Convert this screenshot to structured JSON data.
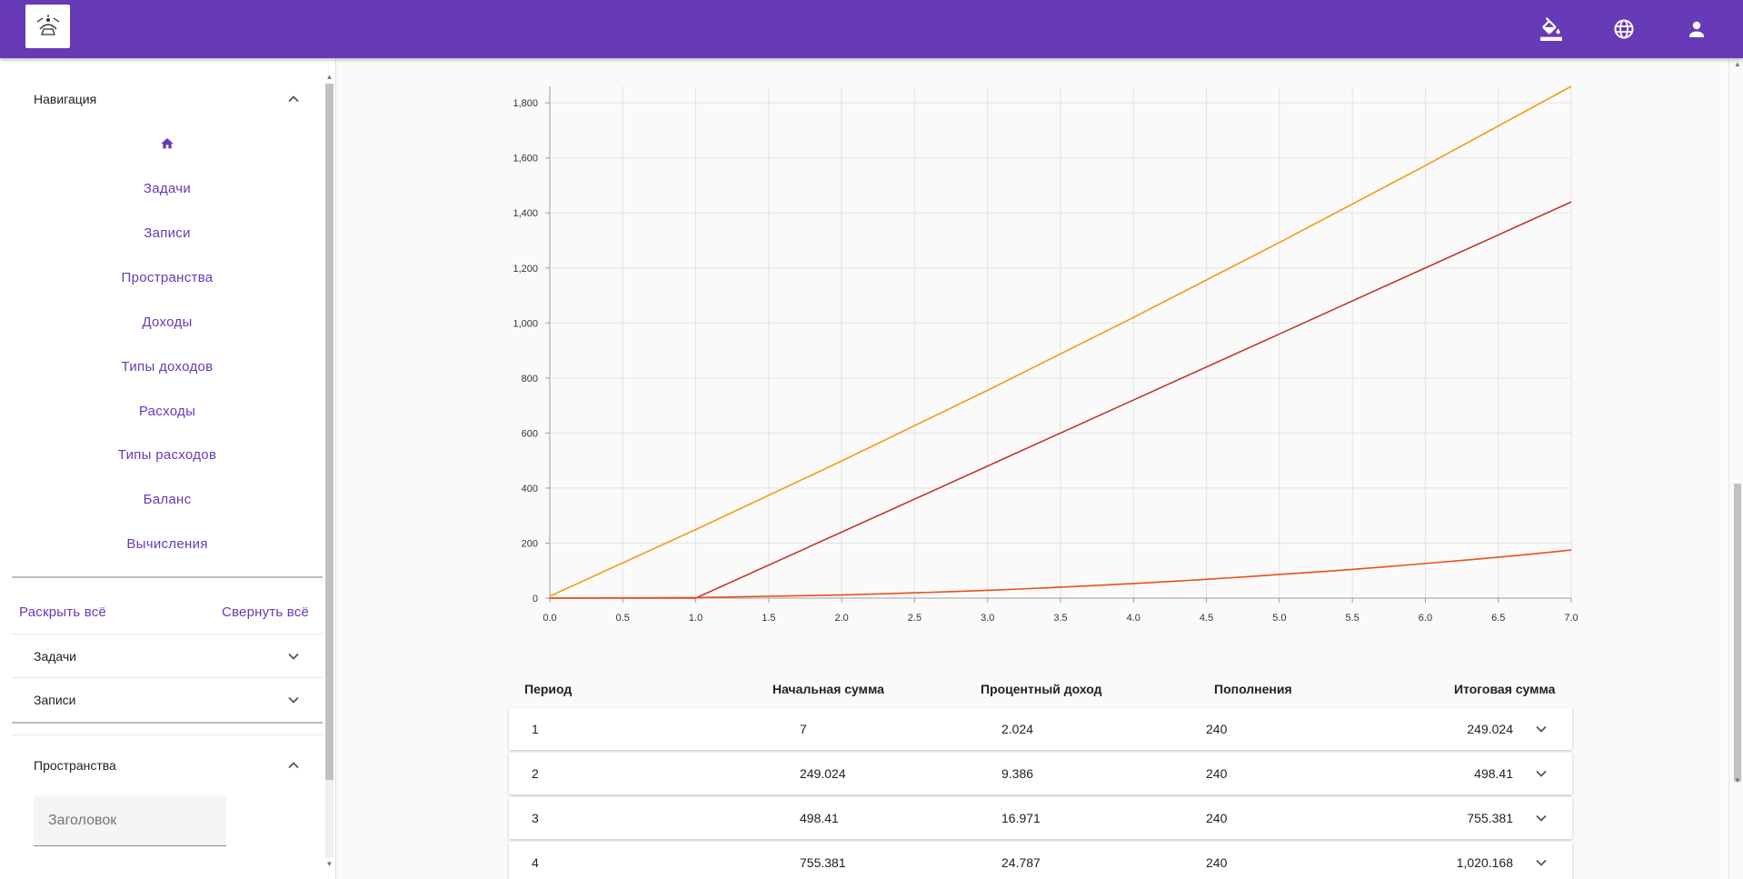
{
  "header": {
    "logo": "app-logo",
    "icons": [
      "paint-bucket-icon",
      "globe-icon",
      "account-icon"
    ]
  },
  "sidebar": {
    "navigation": {
      "title": "Навигация",
      "home_icon": "home-icon",
      "items": [
        "Задачи",
        "Записи",
        "Пространства",
        "Доходы",
        "Типы доходов",
        "Расходы",
        "Типы расходов",
        "Баланс",
        "Вычисления"
      ]
    },
    "expand_all": "Раскрыть всё",
    "collapse_all": "Свернуть всё",
    "panels": [
      {
        "title": "Задачи",
        "state": "collapsed"
      },
      {
        "title": "Записи",
        "state": "collapsed"
      }
    ],
    "spaces": {
      "title": "Пространства",
      "state": "expanded",
      "input_placeholder": "Заголовок"
    }
  },
  "colors": {
    "primary": "#673ab7",
    "series_total": "#f39c12",
    "series_deposits": "#c0392b",
    "series_interest": "#e8501a"
  },
  "chart_data": {
    "type": "line",
    "xlim": [
      0,
      7
    ],
    "ylim": [
      0,
      1860
    ],
    "x_ticks": [
      "0.0",
      "0.5",
      "1.0",
      "1.5",
      "2.0",
      "2.5",
      "3.0",
      "3.5",
      "4.0",
      "4.5",
      "5.0",
      "5.5",
      "6.0",
      "6.5",
      "7.0"
    ],
    "y_ticks": [
      "0",
      "200",
      "400",
      "600",
      "800",
      "1,000",
      "1,200",
      "1,400",
      "1,600",
      "1,800"
    ],
    "grid": true,
    "series": [
      {
        "x": [
          0,
          1,
          2,
          3,
          4,
          5,
          6,
          7
        ],
        "values": [
          7,
          249.024,
          498.41,
          755.381,
          1020.168,
          1292.5,
          1572,
          1860
        ],
        "color": "#f39c12"
      },
      {
        "x": [
          0,
          1,
          2,
          3,
          4,
          5,
          6,
          7
        ],
        "values": [
          0,
          0,
          240,
          480,
          720,
          960,
          1200,
          1440
        ],
        "color": "#c0392b"
      },
      {
        "x": [
          0,
          1,
          2,
          3,
          4,
          5,
          6,
          7
        ],
        "values": [
          0,
          2.024,
          11.41,
          28.381,
          53.168,
          86,
          126,
          175
        ],
        "color": "#e8501a"
      }
    ]
  },
  "table": {
    "headers": [
      "Период",
      "Начальная сумма",
      "Процентный доход",
      "Пополнения",
      "Итоговая сумма"
    ],
    "rows": [
      [
        "1",
        "7",
        "2.024",
        "240",
        "249.024"
      ],
      [
        "2",
        "249.024",
        "9.386",
        "240",
        "498.41"
      ],
      [
        "3",
        "498.41",
        "16.971",
        "240",
        "755.381"
      ],
      [
        "4",
        "755.381",
        "24.787",
        "240",
        "1,020.168"
      ]
    ]
  }
}
